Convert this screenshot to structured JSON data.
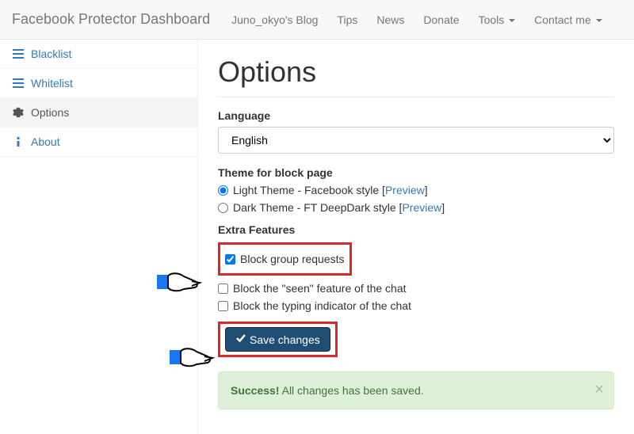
{
  "navbar": {
    "brand": "Facebook Protector Dashboard",
    "items": [
      {
        "label": "Juno_okyo's Blog"
      },
      {
        "label": "Tips"
      },
      {
        "label": "News"
      },
      {
        "label": "Donate"
      },
      {
        "label": "Tools",
        "dropdown": true
      },
      {
        "label": "Contact me",
        "dropdown": true
      }
    ]
  },
  "sidebar": {
    "items": [
      {
        "label": "Blacklist",
        "icon": "list"
      },
      {
        "label": "Whitelist",
        "icon": "list"
      },
      {
        "label": "Options",
        "icon": "gear",
        "active": true
      },
      {
        "label": "About",
        "icon": "info"
      }
    ]
  },
  "options": {
    "title": "Options",
    "language_label": "Language",
    "language_value": "English",
    "theme_label": "Theme for block page",
    "themes": [
      {
        "label": "Light Theme - Facebook style",
        "preview": "Preview",
        "checked": true
      },
      {
        "label": "Dark Theme - FT DeepDark style",
        "preview": "Preview",
        "checked": false
      }
    ],
    "extra_label": "Extra Features",
    "extras": [
      {
        "label": "Block group requests",
        "checked": true
      },
      {
        "label": "Block the \"seen\" feature of the chat",
        "checked": false
      },
      {
        "label": "Block the typing indicator of the chat",
        "checked": false
      }
    ],
    "save_label": "Save changes",
    "alert": {
      "strong": "Success!",
      "text": " All changes has been saved."
    }
  }
}
